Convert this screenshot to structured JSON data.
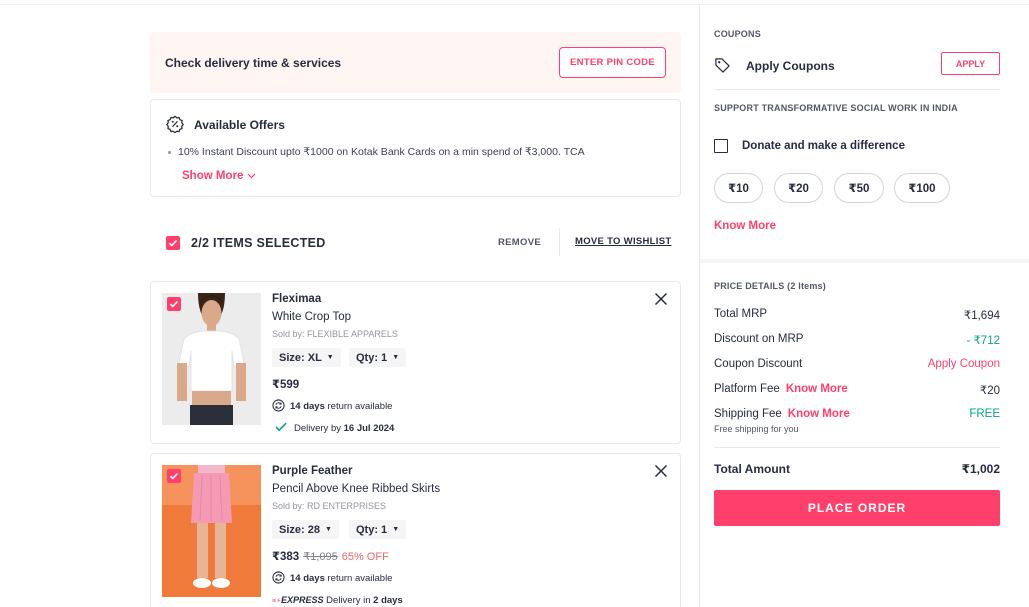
{
  "delivery": {
    "title": "Check delivery time & services",
    "pin_button": "ENTER PIN CODE"
  },
  "offers": {
    "title": "Available Offers",
    "items": [
      "10% Instant Discount upto ₹1000 on Kotak Bank Cards on a min spend of ₹3,000. TCA"
    ],
    "show_more": "Show More"
  },
  "selection": {
    "label": "2/2 ITEMS SELECTED",
    "remove": "REMOVE",
    "move_to_wishlist": "MOVE TO WISHLIST"
  },
  "items": [
    {
      "brand": "Fleximaa",
      "name": "White Crop Top",
      "seller": "Sold by: FLEXIBLE APPARELS",
      "size": "Size: XL",
      "qty": "Qty: 1",
      "price": "₹599",
      "mrp": "",
      "discount": "",
      "return_days": "14 days",
      "return_text": " return available",
      "delivery_prefix": "Delivery by ",
      "delivery_date": "16 Jul 2024"
    },
    {
      "brand": "Purple Feather",
      "name": "Pencil Above Knee Ribbed Skirts",
      "seller": "Sold by: RD ENTERPRISES",
      "size": "Size: 28",
      "qty": "Qty: 1",
      "price": "₹383",
      "mrp": "₹1,095",
      "discount": "65% OFF",
      "return_days": "14 days",
      "return_text": " return available",
      "express_label": "EXPRESS",
      "delivery_prefix": " Delivery in ",
      "delivery_date": "2 days"
    }
  ],
  "coupons": {
    "heading": "COUPONS",
    "label": "Apply Coupons",
    "button": "APPLY"
  },
  "donation": {
    "heading": "SUPPORT TRANSFORMATIVE SOCIAL WORK IN INDIA",
    "label": "Donate and make a difference",
    "amounts": [
      "₹10",
      "₹20",
      "₹50",
      "₹100"
    ],
    "know_more": "Know More"
  },
  "price_details": {
    "heading": "PRICE DETAILS (2 Items)",
    "total_mrp_label": "Total MRP",
    "total_mrp": "₹1,694",
    "discount_label": "Discount on MRP",
    "discount": "- ₹712",
    "coupon_label": "Coupon Discount",
    "coupon_value": "Apply Coupon",
    "platform_label": "Platform Fee",
    "platform_know_more": "Know More",
    "platform_fee": "₹20",
    "shipping_label": "Shipping Fee",
    "shipping_know_more": "Know More",
    "shipping_fee": "FREE",
    "shipping_note": "Free shipping for you",
    "total_label": "Total Amount",
    "total": "₹1,002",
    "place_order": "PLACE ORDER"
  },
  "colors": {
    "accent": "#ff3f6c",
    "green": "#03a685",
    "discount_red": "#f16565"
  }
}
